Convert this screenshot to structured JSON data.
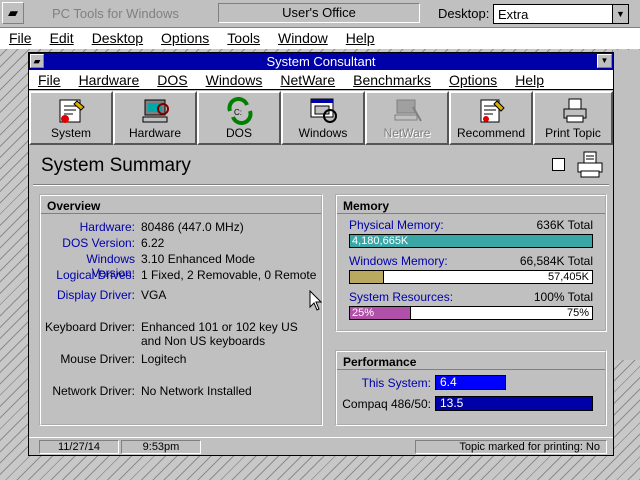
{
  "outer": {
    "title": "PC Tools for Windows",
    "office_label": "User's Office",
    "desktop_label": "Desktop:",
    "desktop_value": "Extra",
    "menu": [
      "File",
      "Edit",
      "Desktop",
      "Options",
      "Tools",
      "Window",
      "Help"
    ]
  },
  "window": {
    "title": "System Consultant",
    "menu": [
      "File",
      "Hardware",
      "DOS",
      "Windows",
      "NetWare",
      "Benchmarks",
      "Options",
      "Help"
    ],
    "toolbar": [
      {
        "label": "System",
        "icon": "system-icon",
        "enabled": true
      },
      {
        "label": "Hardware",
        "icon": "hardware-icon",
        "enabled": true
      },
      {
        "label": "DOS",
        "icon": "dos-icon",
        "enabled": true
      },
      {
        "label": "Windows",
        "icon": "windows-icon",
        "enabled": true
      },
      {
        "label": "NetWare",
        "icon": "netware-icon",
        "enabled": false
      },
      {
        "label": "Recommend",
        "icon": "recommend-icon",
        "enabled": true
      },
      {
        "label": "Print Topic",
        "icon": "printer-icon",
        "enabled": true
      }
    ]
  },
  "summary": {
    "title": "System Summary",
    "overview": {
      "title": "Overview",
      "rows": [
        {
          "label": "Hardware:",
          "value": "80486 (447.0 MHz)",
          "link": true
        },
        {
          "label": "DOS Version:",
          "value": "6.22",
          "link": true
        },
        {
          "label": "Windows Version:",
          "value": "3.10 Enhanced Mode",
          "link": true
        },
        {
          "label": "Logical Drives:",
          "value": "1 Fixed, 2 Removable, 0 Remote",
          "link": true
        },
        {
          "label": "Display Driver:",
          "value": "VGA",
          "link": true
        },
        {
          "label": "Keyboard Driver:",
          "value": "Enhanced 101 or 102 key US and Non US keyboards",
          "link": false
        },
        {
          "label": "Mouse Driver:",
          "value": "Logitech",
          "link": false
        },
        {
          "label": "Network Driver:",
          "value": "No Network Installed",
          "link": false
        }
      ]
    },
    "memory": {
      "title": "Memory",
      "items": [
        {
          "label": "Physical Memory:",
          "total": "636K Total",
          "bar_text": "4,180,665K",
          "right_text": "",
          "fill": 1.0,
          "color": "#3aa6a6"
        },
        {
          "label": "Windows Memory:",
          "total": "66,584K Total",
          "bar_text": "",
          "right_text": "57,405K",
          "fill": 0.14,
          "color": "#b8a860"
        },
        {
          "label": "System Resources:",
          "total": "100% Total",
          "bar_text": "25%",
          "right_text": "75%",
          "fill": 0.25,
          "color": "#b050a8"
        }
      ]
    },
    "performance": {
      "title": "Performance",
      "items": [
        {
          "label": "This System:",
          "value": "6.4",
          "fill": 0.45,
          "color": "#0000ff"
        },
        {
          "label": "Compaq 486/50:",
          "value": "13.5",
          "fill": 1.0,
          "color": "#0000a8"
        }
      ]
    }
  },
  "status": {
    "date": "11/27/14",
    "time": "9:53pm",
    "message": "Topic marked for printing: No"
  }
}
